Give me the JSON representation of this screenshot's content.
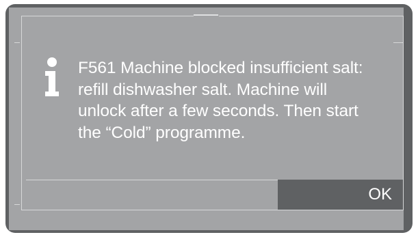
{
  "dialog": {
    "icon": "info-icon",
    "message": "F561 Machine blocked insufficient salt:\nrefill dishwasher salt. Machine will\nunlock after a few seconds. Then start\nthe “Cold” programme.",
    "ok_label": "OK"
  },
  "colors": {
    "device_frame": "#5f6163",
    "screen_background": "#a3a4a6",
    "text": "#ffffff",
    "button_background": "#5f6163",
    "divider": "#d7d8d9"
  }
}
